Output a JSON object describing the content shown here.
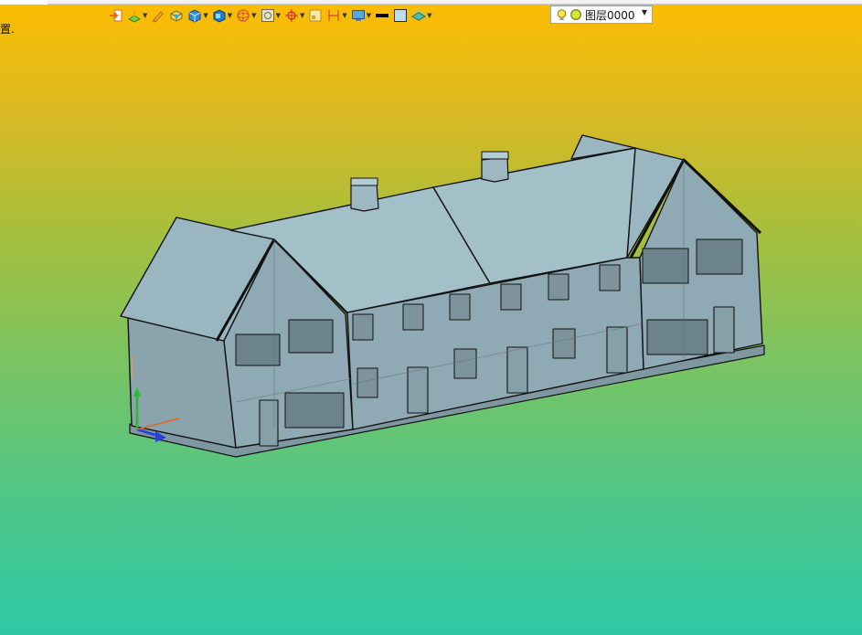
{
  "prompt_text": "置.",
  "toolbar": {
    "icons": [
      "exit-sketch-icon",
      "sketch-plane-icon",
      "pen-icon",
      "extrude-icon",
      "box-solid-icon",
      "shell-icon",
      "sphere-wire-icon",
      "image-frame-icon",
      "crosshair-icon",
      "rectangle-icon",
      "dimension-icon",
      "view-icon",
      "line-color-icon",
      "fill-color-icon",
      "surface-icon"
    ]
  },
  "layer": {
    "name": "图层0000",
    "bulb_color": "#fbe34b",
    "circle_color": "#d5e632"
  },
  "colors": {
    "bg_top": "#fdbd00",
    "bg_bottom": "#2fc8a6",
    "model_face": "#8ea9b3",
    "model_roof": "#a3bfc8",
    "edge": "#111111"
  }
}
